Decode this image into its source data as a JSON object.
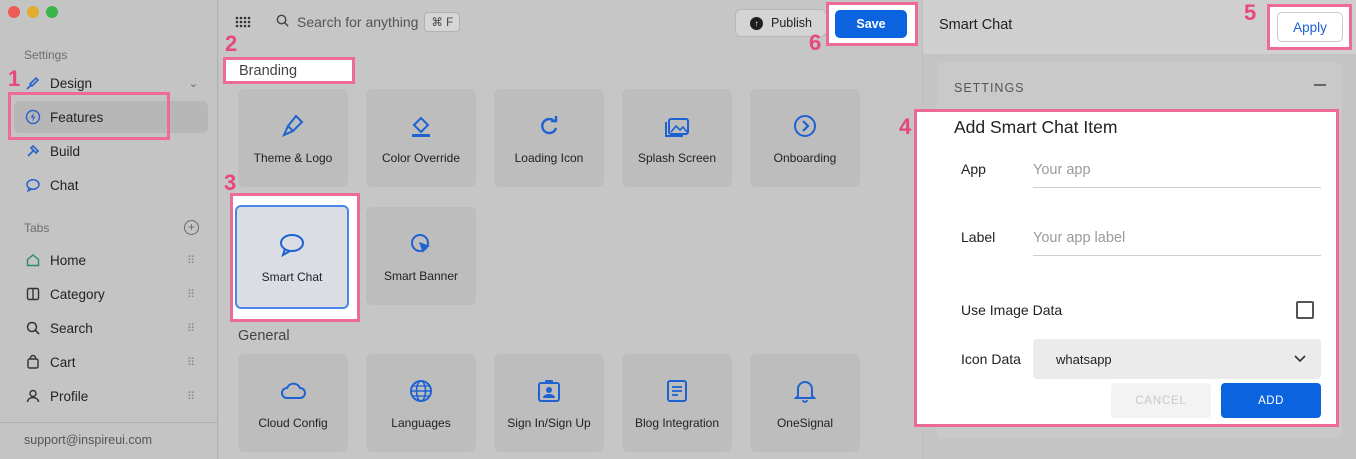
{
  "sidebar": {
    "settings_label": "Settings",
    "items": [
      {
        "label": "Design",
        "icon": "design-brush-icon"
      },
      {
        "label": "Features",
        "icon": "bolt-icon"
      },
      {
        "label": "Build",
        "icon": "hammer-icon"
      },
      {
        "label": "Chat",
        "icon": "chat-icon"
      }
    ],
    "tabs_label": "Tabs",
    "tabs": [
      {
        "label": "Home",
        "icon": "home-icon"
      },
      {
        "label": "Category",
        "icon": "category-icon"
      },
      {
        "label": "Search",
        "icon": "search-icon"
      },
      {
        "label": "Cart",
        "icon": "cart-icon"
      },
      {
        "label": "Profile",
        "icon": "profile-icon"
      }
    ],
    "support_email": "support@inspireui.com"
  },
  "toolbar": {
    "search_placeholder": "Search for anything",
    "search_shortcut": "⌘ F",
    "publish_label": "Publish",
    "save_label": "Save"
  },
  "main": {
    "branding_label": "Branding",
    "general_label": "General",
    "branding_tiles": [
      {
        "label": "Theme & Logo",
        "icon": "paintbrush-icon"
      },
      {
        "label": "Color Override",
        "icon": "paint-bucket-icon"
      },
      {
        "label": "Loading Icon",
        "icon": "refresh-icon"
      },
      {
        "label": "Splash Screen",
        "icon": "image-stack-icon"
      },
      {
        "label": "Onboarding",
        "icon": "arrow-circle-icon"
      },
      {
        "label": "Smart Chat",
        "icon": "speech-bubble-icon"
      },
      {
        "label": "Smart Banner",
        "icon": "cursor-target-icon"
      }
    ],
    "general_tiles": [
      {
        "label": "Cloud Config",
        "icon": "cloud-icon"
      },
      {
        "label": "Languages",
        "icon": "globe-icon"
      },
      {
        "label": "Sign In/Sign Up",
        "icon": "id-card-icon"
      },
      {
        "label": "Blog Integration",
        "icon": "article-icon"
      },
      {
        "label": "OneSignal",
        "icon": "bell-icon"
      }
    ]
  },
  "panel": {
    "title": "Smart Chat",
    "apply_label": "Apply",
    "settings_header": "SETTINGS",
    "form_title": "Add Smart Chat Item",
    "app_label": "App",
    "app_placeholder": "Your app",
    "label_label": "Label",
    "label_placeholder": "Your app label",
    "use_image_label": "Use Image Data",
    "icon_data_label": "Icon Data",
    "icon_data_value": "whatsapp",
    "cancel_label": "CANCEL",
    "add_label": "ADD"
  },
  "annotations": [
    "1",
    "2",
    "3",
    "4",
    "5",
    "6"
  ],
  "colors": {
    "accent": "#0b63e0",
    "annotation": "#ee6b98",
    "icon_blue": "#1e62d2"
  }
}
